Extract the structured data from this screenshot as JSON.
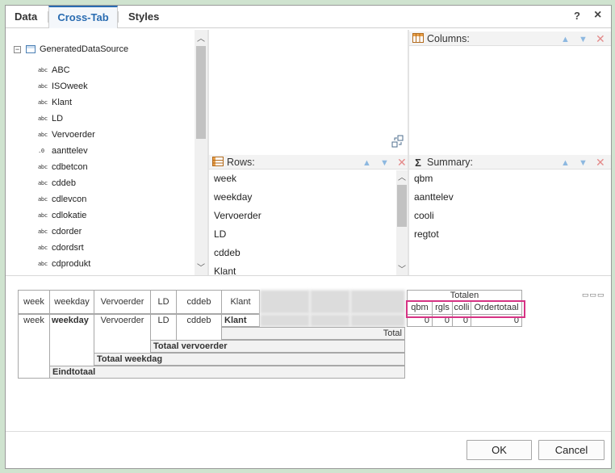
{
  "tabs": [
    {
      "label": "Data"
    },
    {
      "label": "Cross-Tab"
    },
    {
      "label": "Styles"
    }
  ],
  "window_buttons": {
    "help": "?",
    "close": "×"
  },
  "tree": {
    "root": "GeneratedDataSource",
    "items": [
      {
        "type": "abc",
        "label": "ABC"
      },
      {
        "type": "abc",
        "label": "ISOweek"
      },
      {
        "type": "abc",
        "label": "Klant"
      },
      {
        "type": "abc",
        "label": "LD"
      },
      {
        "type": "abc",
        "label": "Vervoerder"
      },
      {
        "type": ".0",
        "label": "aanttelev"
      },
      {
        "type": "abc",
        "label": "cdbetcon"
      },
      {
        "type": "abc",
        "label": "cddeb"
      },
      {
        "type": "abc",
        "label": "cdlevcon"
      },
      {
        "type": "abc",
        "label": "cdlokatie"
      },
      {
        "type": "abc",
        "label": "cdorder"
      },
      {
        "type": "abc",
        "label": "cdordsrt"
      },
      {
        "type": "abc",
        "label": "cdprodukt"
      }
    ]
  },
  "columns_zone": {
    "title": "Columns:"
  },
  "rows_zone": {
    "title": "Rows:",
    "items": [
      "week",
      "weekday",
      "Vervoerder",
      "LD",
      "cddeb",
      "Klant"
    ]
  },
  "summary_zone": {
    "title": "Summary:",
    "items": [
      "qbm",
      "aanttelev",
      "cooli",
      "regtot"
    ]
  },
  "crosstab": {
    "row_headers": [
      "week",
      "weekday",
      "Vervoerder",
      "LD",
      "cddeb",
      "Klant"
    ],
    "row_values": [
      "week",
      "weekday",
      "Vervoerder",
      "LD",
      "cddeb",
      "Klant"
    ],
    "totals_header": "Totalen",
    "measure_headers": [
      "qbm",
      "rgls",
      "colli",
      "Ordertotaal"
    ],
    "measure_values": [
      "0",
      "0",
      "0",
      "0"
    ],
    "total_label": "Total",
    "subtotal_vervoerder": "Totaal vervoerder",
    "subtotal_weekday": "Totaal weekdag",
    "grand_total": "Eindtotaal"
  },
  "buttons": {
    "ok": "OK",
    "cancel": "Cancel"
  },
  "colors": {
    "accent": "#2a6cb1",
    "highlight": "#d63384"
  }
}
